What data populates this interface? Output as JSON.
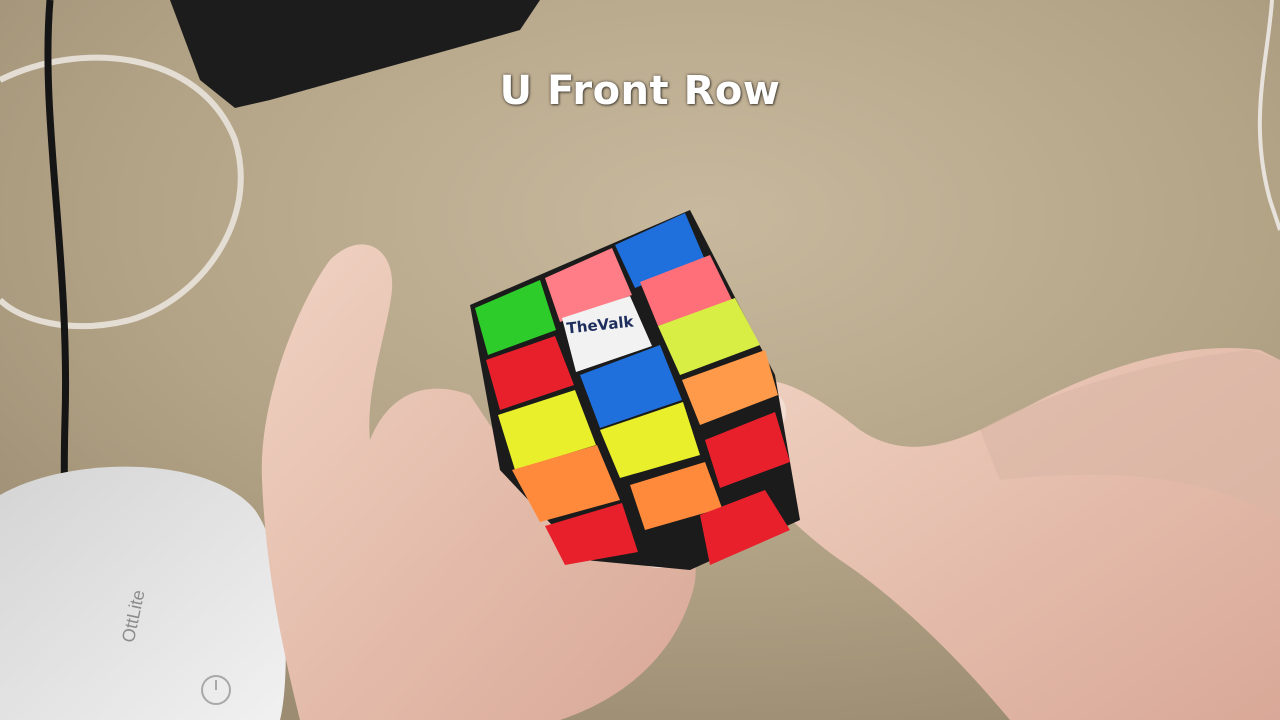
{
  "caption": "U Front Row",
  "cube": {
    "brand_text": "TheValk",
    "sticker_colors": {
      "green": "#2ecc2a",
      "blue": "#1f6fdc",
      "red": "#e8202c",
      "pink": "#ff6f7a",
      "yellow": "#e9ef2a",
      "orange": "#ff8a3c",
      "white": "#f2f2f2"
    }
  },
  "lamp": {
    "brand_text": "OttLite"
  },
  "colors": {
    "desk": "#b5a58c",
    "skin": "#e8c4b2",
    "caption": "#ffffff"
  }
}
